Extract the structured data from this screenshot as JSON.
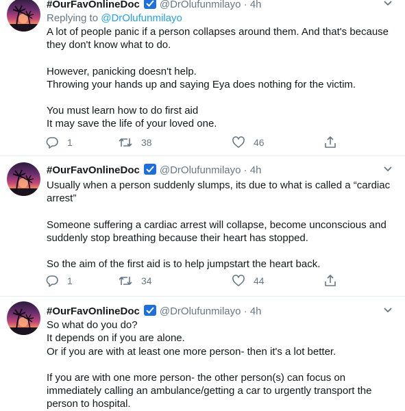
{
  "colors": {
    "text": "#14171a",
    "secondary": "#657786",
    "link": "#1da1f2",
    "divider": "#e6ecf0"
  },
  "tweets": [
    {
      "name": "#OurFavOnlineDoc",
      "handle": "@DrOlufunmilayo",
      "dot": "·",
      "time": "4h",
      "replying_prefix": "Replying to",
      "replying_to": "@DrOlufunmilayo",
      "lines": [
        "A lot of people panic if a person collapses around them. And that's because",
        "they don't know what to do.",
        "",
        "However, panicking doesn't help.",
        "Throwing your hands up and saying Eya does nothing for the victim.",
        "",
        "You must learn how to do first aid",
        "It may save the life of your loved one."
      ],
      "replies": "1",
      "retweets": "38",
      "likes": "46"
    },
    {
      "name": "#OurFavOnlineDoc",
      "handle": "@DrOlufunmilayo",
      "dot": "·",
      "time": "4h",
      "lines": [
        "Usually when a person suddenly slumps, its due to what is called a “cardiac",
        "arrest”",
        "",
        "Someone suffering a cardiac arrest will collapse, become unconscious and",
        "suddenly stop breathing because their heart has stopped.",
        "",
        "So the aim of the first aid is to help jumpstart the heart back."
      ],
      "replies": "1",
      "retweets": "34",
      "likes": "44"
    },
    {
      "name": "#OurFavOnlineDoc",
      "handle": "@DrOlufunmilayo",
      "dot": "·",
      "time": "4h",
      "lines": [
        "So what do you do?",
        "It depends on if you are alone.",
        "Or if you are with at least one more person- then it's a lot better.",
        "",
        "If you are with one more person- the other person(s) can focus on",
        "immediately calling an ambulance/getting a car to urgently transport the",
        "person to hospital."
      ]
    }
  ],
  "icons": {
    "verified": "verified-badge-icon",
    "caret": "chevron-down-icon",
    "reply": "reply-bubble-icon",
    "retweet": "retweet-icon",
    "like": "heart-icon",
    "share": "share-icon"
  }
}
